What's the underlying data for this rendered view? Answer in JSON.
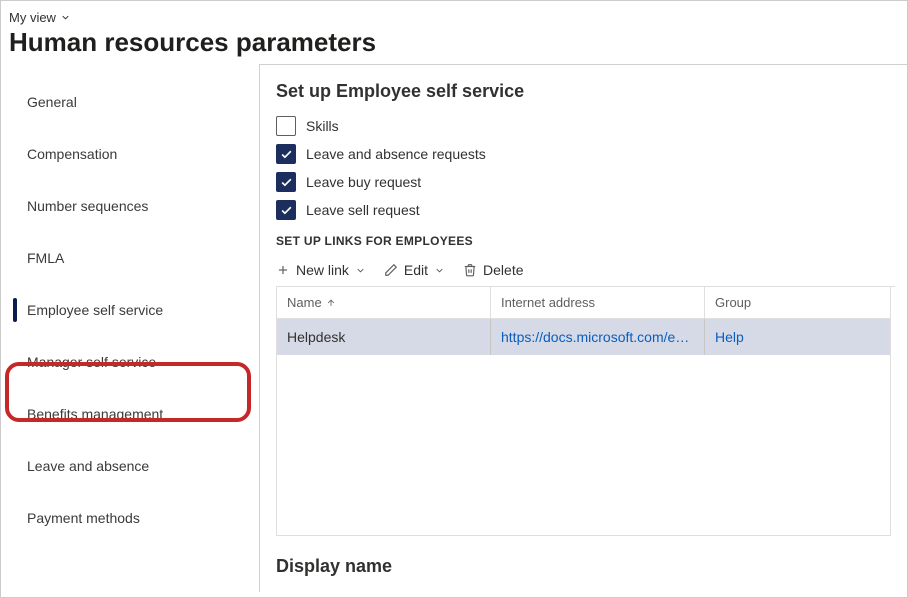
{
  "header": {
    "view_label": "My view",
    "page_title": "Human resources parameters"
  },
  "sidebar": {
    "items": [
      {
        "label": "General",
        "name": "sidebar-item-general"
      },
      {
        "label": "Compensation",
        "name": "sidebar-item-compensation"
      },
      {
        "label": "Number sequences",
        "name": "sidebar-item-number-sequences"
      },
      {
        "label": "FMLA",
        "name": "sidebar-item-fmla"
      },
      {
        "label": "Employee self service",
        "name": "sidebar-item-employee-self-service",
        "selected": true,
        "highlighted": true
      },
      {
        "label": "Manager self service",
        "name": "sidebar-item-manager-self-service"
      },
      {
        "label": "Benefits management",
        "name": "sidebar-item-benefits-management"
      },
      {
        "label": "Leave and absence",
        "name": "sidebar-item-leave-and-absence"
      },
      {
        "label": "Payment methods",
        "name": "sidebar-item-payment-methods"
      }
    ]
  },
  "content": {
    "section_title": "Set up Employee self service",
    "checkboxes": [
      {
        "label": "Skills",
        "checked": false
      },
      {
        "label": "Leave and absence requests",
        "checked": true
      },
      {
        "label": "Leave buy request",
        "checked": true
      },
      {
        "label": "Leave sell request",
        "checked": true
      }
    ],
    "links_section_header": "SET UP LINKS FOR EMPLOYEES",
    "toolbar": {
      "new_link": "New link",
      "edit": "Edit",
      "delete": "Delete"
    },
    "grid": {
      "columns": [
        {
          "label": "Name",
          "sorted": "asc"
        },
        {
          "label": "Internet address",
          "sorted": null
        },
        {
          "label": "Group",
          "sorted": null
        }
      ],
      "rows": [
        {
          "name": "Helpdesk",
          "url": "https://docs.microsoft.com/en-u...",
          "group": "Help"
        }
      ]
    },
    "display_name_header": "Display name"
  }
}
